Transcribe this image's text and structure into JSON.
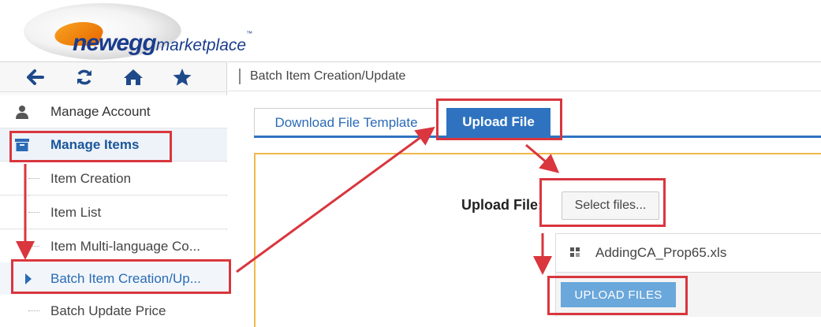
{
  "logo": {
    "brand": "newegg",
    "sub": "marketplace",
    "tm": "™"
  },
  "toolbar": {
    "icons": [
      "back-arrow-icon",
      "refresh-icon",
      "home-icon",
      "star-icon"
    ]
  },
  "sidebar": {
    "sections": [
      {
        "label": "Manage Account",
        "icon": "user-icon"
      },
      {
        "label": "Manage Items",
        "icon": "box-icon"
      }
    ],
    "items": [
      {
        "label": "Item Creation"
      },
      {
        "label": "Item List"
      },
      {
        "label": "Item Multi-language Co..."
      },
      {
        "label": "Batch Item Creation/Up..."
      },
      {
        "label": "Batch Update Price"
      }
    ]
  },
  "breadcrumb": {
    "current": "Batch Item Creation/Update"
  },
  "tabs": [
    {
      "label": "Download File Template"
    },
    {
      "label": "Upload File"
    }
  ],
  "upload": {
    "field_label": "Upload File:",
    "select_label": "Select files...",
    "file_name": "AddingCA_Prop65.xls",
    "submit_label": "UPLOAD FILES"
  },
  "colors": {
    "accent": "#2f73c0",
    "annotation": "#d9363e",
    "panel_border": "#f0b94a",
    "brand": "#1a3c8c"
  }
}
